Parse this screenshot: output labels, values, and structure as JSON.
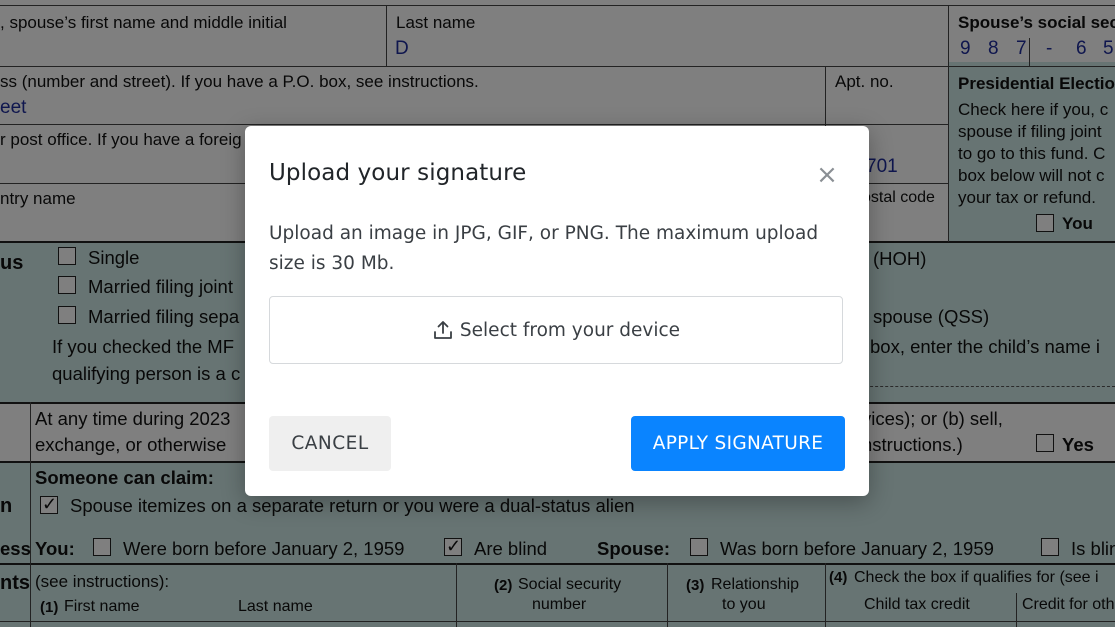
{
  "form": {
    "spouse_name_label": ", spouse’s first name and middle initial",
    "last_name_label": "Last name",
    "last_name_value": "D",
    "spouse_ssn_label": "Spouse’s social secu",
    "spouse_ssn_digits": [
      "9",
      "8",
      "7",
      "-",
      "6",
      "5"
    ],
    "address_label": "ss (number and street). If you have a P.O. box, see instructions.",
    "address_value": "eet",
    "apt_label": "Apt. no.",
    "pec_title": "Presidential Electio",
    "pec_lines": [
      "Check here if you, c",
      "spouse if filing joint",
      "to go to this fund. C",
      "box below will not c",
      "your tax or refund."
    ],
    "pec_you_label": "You",
    "city_label": "r post office. If you have a foreig",
    "zip_value": "701",
    "country_label": "ntry name",
    "postal_label": "ostal code",
    "filing_status_label": "us",
    "single_label": "Single",
    "mfj_label": "Married filing joint",
    "mfs_label": "Married filing sepa",
    "hoh_label": "(HOH)",
    "qss_label": "spouse (QSS)",
    "mfs_note_1": "If you checked the MF",
    "mfs_note_2": "qualifying person is a c",
    "child_note": "box, enter the child’s name i",
    "digital_q1": "At any time during 2023",
    "digital_q2": "exchange, or otherwise",
    "digital_r1": "vices); or (b) sell,",
    "digital_r2": "nstructions.)",
    "yes_label": "Yes",
    "someone_claim": "Someone can claim:",
    "std_label": "n",
    "spouse_itemizes": "Spouse itemizes on a separate return or you were a dual-status alien",
    "age_label": "ess",
    "you_label": "You:",
    "born_before": "Were born before January 2, 1959",
    "are_blind": "Are blind",
    "spouse_label": "Spouse:",
    "was_born_before": "Was born before January 2, 1959",
    "is_blind": "Is blin",
    "dependents_label": "nts",
    "see_instructions": "(see instructions):",
    "first_name_num": "(1)",
    "first_name": "First name",
    "dep_last_name": "Last name",
    "ssn_num": "(2)",
    "ssn_col": "Social security",
    "ssn_col2": "number",
    "rel_num": "(3)",
    "rel_col": "Relationship",
    "rel_col2": "to you",
    "check_num": "(4)",
    "check_col": "Check the box if qualifies for (see i",
    "child_tax_credit": "Child tax credit",
    "credit_other": "Credit for oth"
  },
  "modal": {
    "title": "Upload your signature",
    "close_glyph": "×",
    "description": "Upload an image in JPG, GIF, or PNG. The maximum upload size is 30 Mb.",
    "upload_label": "Select from your device",
    "cancel_label": "CANCEL",
    "apply_label": "APPLY SIGNATURE"
  },
  "colors": {
    "primary": "#0a84ff",
    "form_teal": "#cfe9e6",
    "overlay": "rgba(0,0,0,0.5)"
  },
  "icons": {
    "upload": "upload-icon",
    "close": "close-icon"
  }
}
